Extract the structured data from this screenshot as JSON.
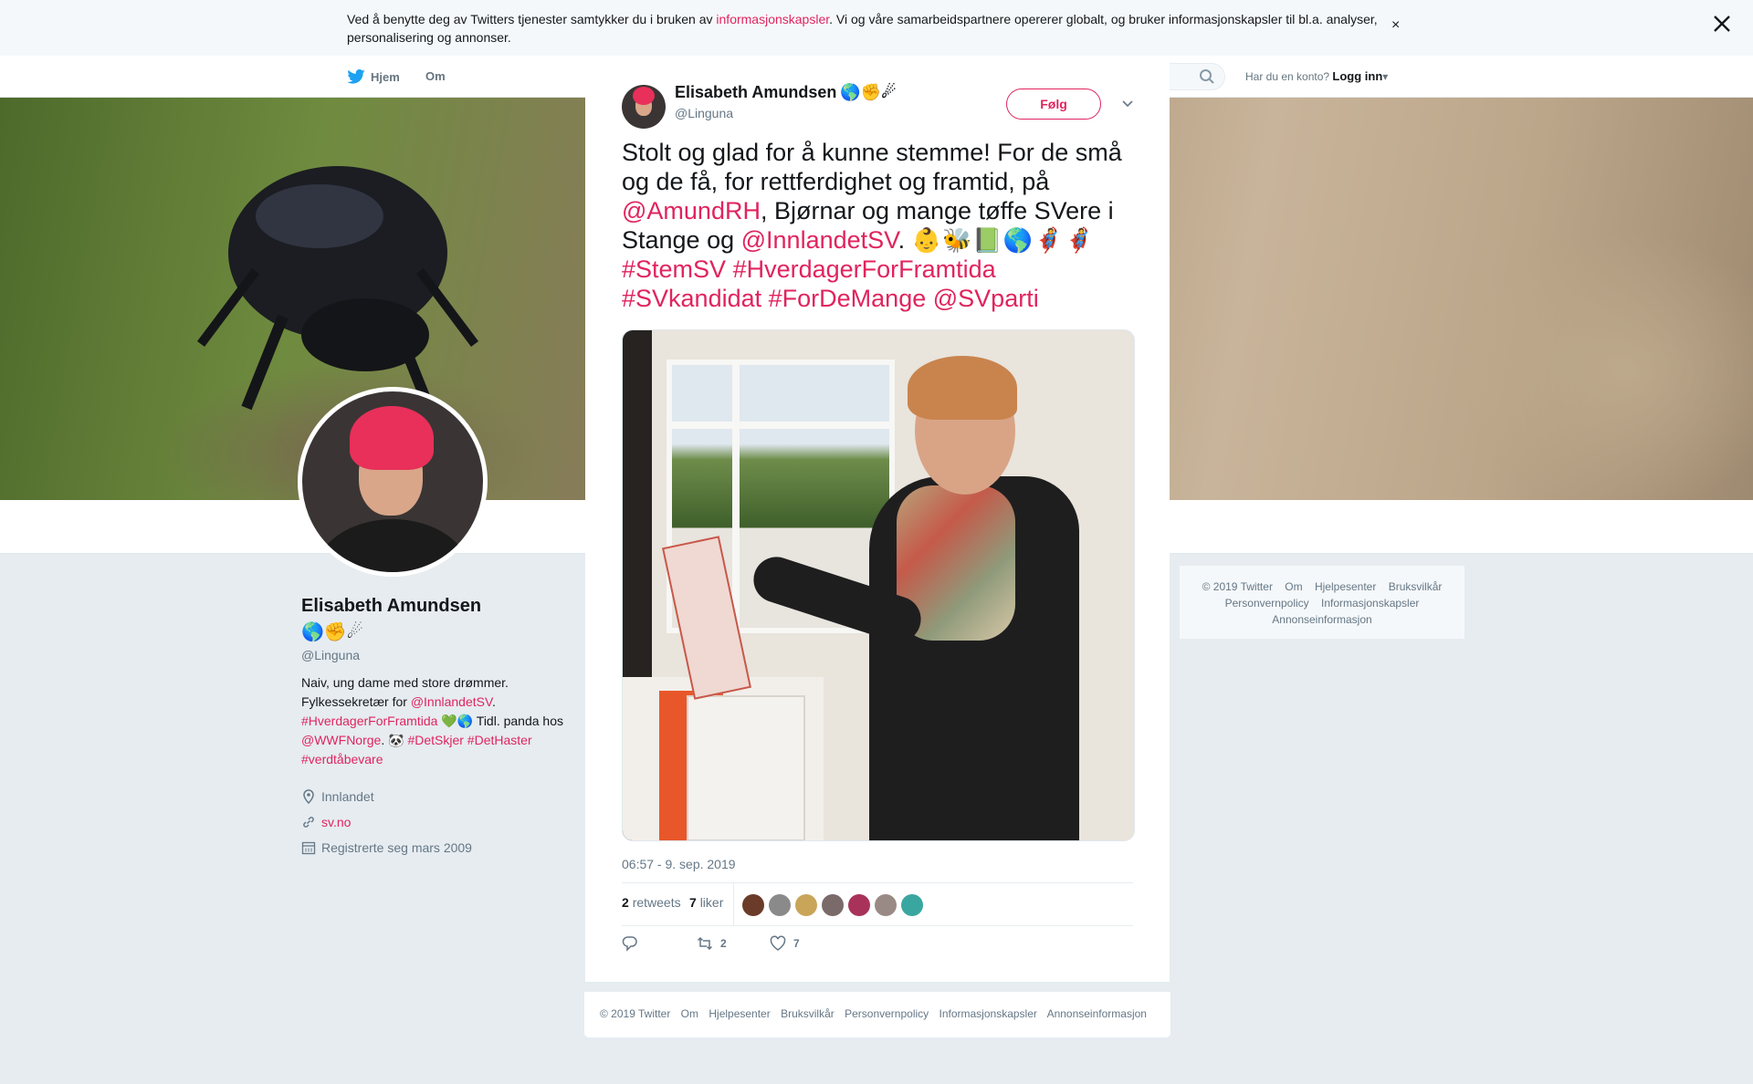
{
  "cookie_banner": {
    "text_before": "Ved å benytte deg av Twitters tjenester samtykker du i bruken av ",
    "link": "informasjonskapsler",
    "text_after": ". Vi og våre samarbeidspartnere opererer globalt, og bruker informasjonskapsler til bl.a. analyser, personalisering og annonser.",
    "close": "×"
  },
  "nav": {
    "home": "Hjem",
    "about": "Om",
    "account_prompt": "Har du en konto?",
    "login": "Logg inn"
  },
  "profile": {
    "name": "Elisabeth Amundsen",
    "emojis": "🌎✊☄",
    "handle": "@Linguna",
    "bio": {
      "t1": "Naiv, ung dame med store drømmer. Fylkessekretær for ",
      "l1": "@InnlandetSV",
      "t2": ". ",
      "l2": "#HverdagerForFramtida",
      "t3": " 💚🌎 Tidl. panda hos ",
      "l3": "@WWFNorge",
      "t4": ". 🐼 ",
      "l4": "#DetSkjer",
      "t5": " ",
      "l5": "#DetHaster",
      "t6": " ",
      "l6": "#verdtåbevare"
    },
    "location": "Innlandet",
    "website": "sv.no",
    "joined": "Registrerte seg mars 2009"
  },
  "side_footer": [
    "© 2019 Twitter",
    "Om",
    "Hjelpesenter",
    "Bruksvilkår",
    "Personvernpolicy",
    "Informasjonskapsler",
    "Annonseinformasjon"
  ],
  "tweet": {
    "author_name": "Elisabeth Amundsen",
    "author_emojis": "🌎✊☄",
    "author_handle": "@Linguna",
    "follow_label": "Følg",
    "text": {
      "t1": "Stolt og glad for å kunne stemme! For de små og de få, for rettferdighet og framtid, på ",
      "m1": "@AmundRH",
      "t2": ", Bjørnar og mange tøffe SVere i Stange og ",
      "m2": "@InnlandetSV",
      "t3": ". ",
      "emojis": "👶🐝📗🌎🦸🦸",
      "h1": "#StemSV",
      "h2": "#HverdagerForFramtida",
      "h3": "#SVkandidat",
      "h4": "#ForDeMange",
      "m3": "@SVparti"
    },
    "timestamp": "06:57 - 9. sep. 2019",
    "retweets_count": "2",
    "retweets_label": "retweets",
    "likes_count": "7",
    "likes_label": "liker",
    "liker_colors": [
      "#6b3b2a",
      "#8a8a8a",
      "#c9a55a",
      "#7a6a6a",
      "#a8325a",
      "#9a8a86",
      "#3aa6a0"
    ],
    "action_retweets": "2",
    "action_likes": "7"
  },
  "modal_footer": [
    "© 2019 Twitter",
    "Om",
    "Hjelpesenter",
    "Bruksvilkår",
    "Personvernpolicy",
    "Informasjonskapsler",
    "Annonseinformasjon"
  ],
  "colors": {
    "accent": "#e0245e",
    "text": "#14171a",
    "secondary": "#657786",
    "background": "#e6ecf0"
  }
}
